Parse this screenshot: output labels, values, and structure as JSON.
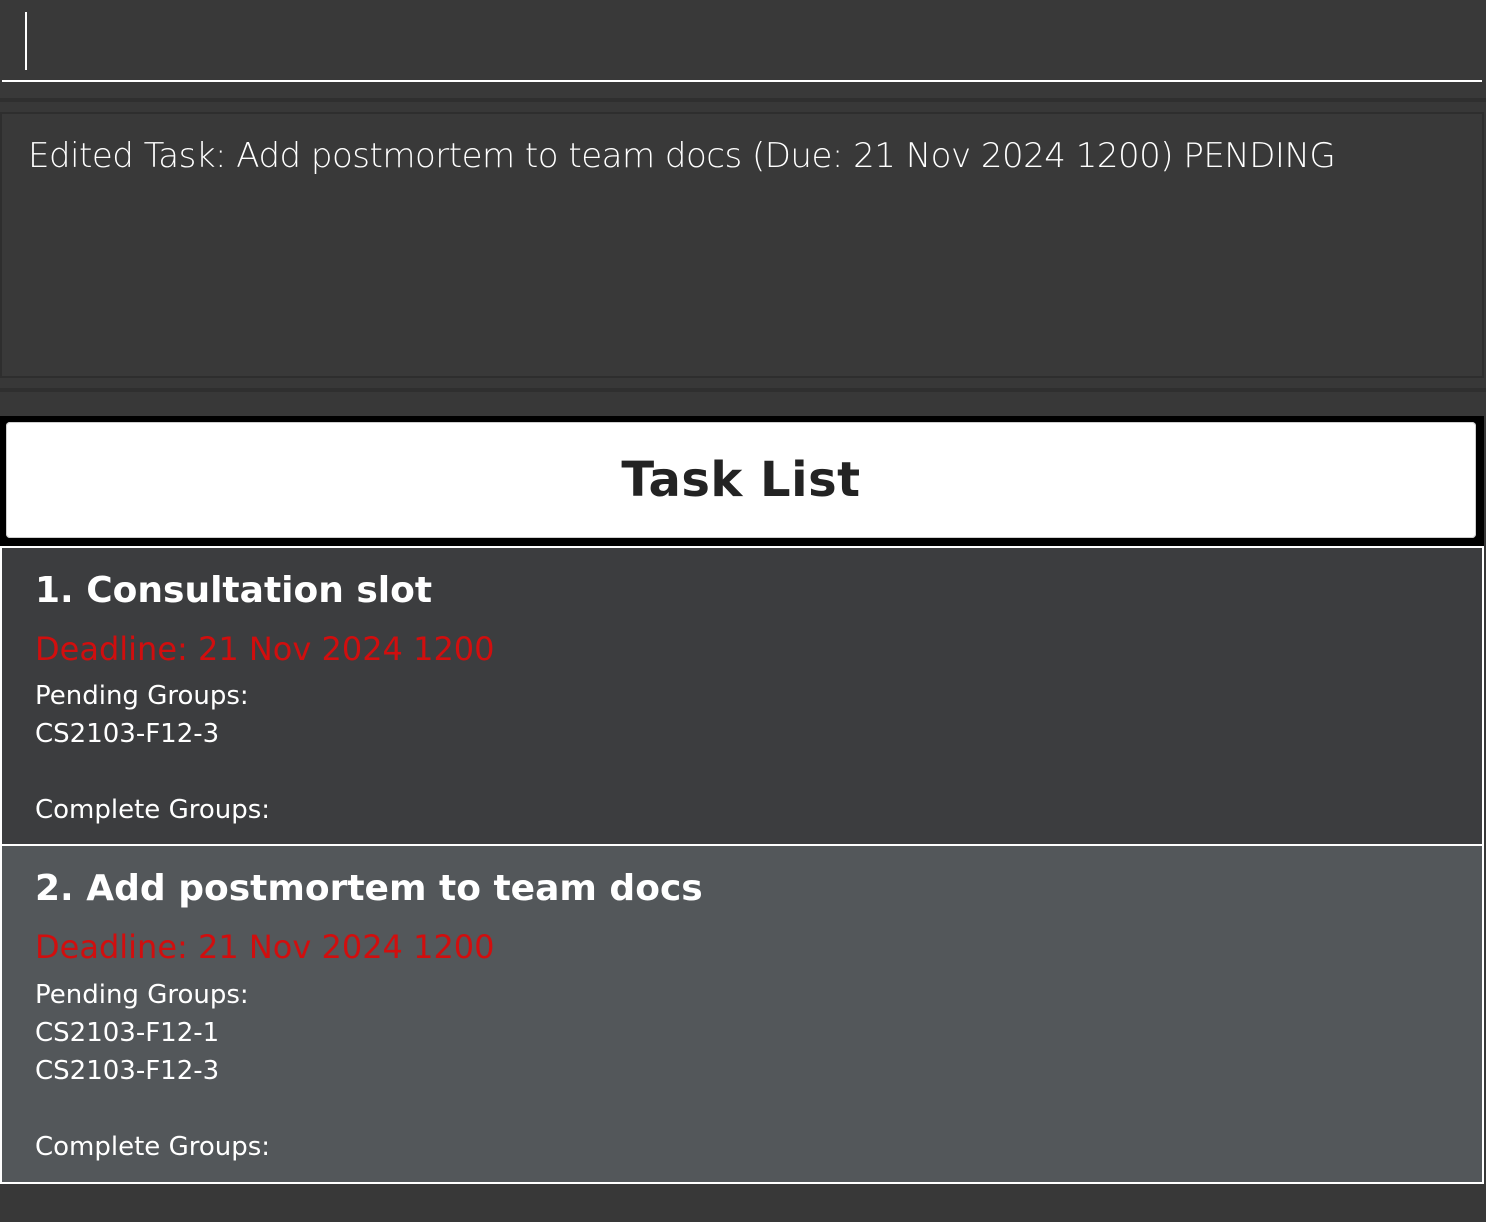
{
  "command_box": {
    "value": "",
    "placeholder": ""
  },
  "result_display": {
    "message": "Edited Task: Add postmortem to team docs (Due: 21 Nov 2024 1200) PENDING"
  },
  "task_list": {
    "title": "Task List",
    "tasks": [
      {
        "title": "1. Consultation slot",
        "deadline": "Deadline: 21 Nov 2024 1200",
        "pending_label": "Pending Groups:",
        "pending_groups": [
          "CS2103-F12-3"
        ],
        "complete_label": "Complete Groups:",
        "complete_groups": []
      },
      {
        "title": "2. Add postmortem to team docs",
        "deadline": "Deadline: 21 Nov 2024 1200",
        "pending_label": "Pending Groups:",
        "pending_groups": [
          "CS2103-F12-1",
          "CS2103-F12-3"
        ],
        "complete_label": "Complete Groups:",
        "complete_groups": []
      }
    ]
  },
  "colors": {
    "background": "#383838",
    "header_background": "#ffffff",
    "deadline": "#d10e0e",
    "card_selected": "#3c3d3f",
    "card_alt": "#53575a"
  }
}
